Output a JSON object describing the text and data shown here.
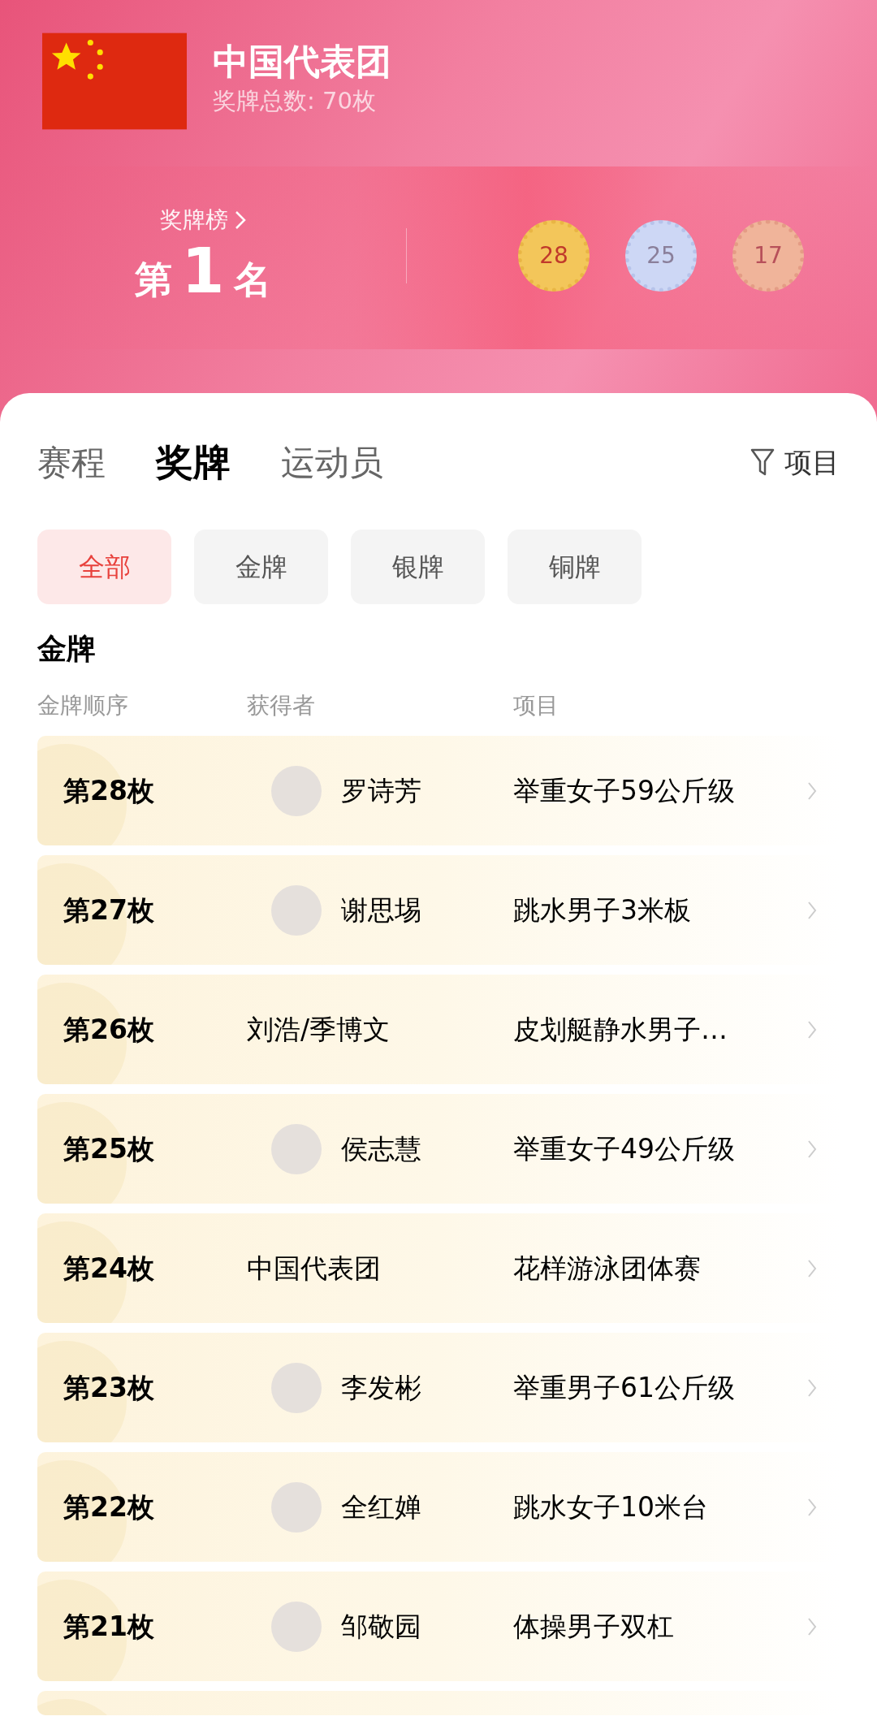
{
  "header": {
    "team": "中国代表团",
    "total": "奖牌总数: 70枚",
    "rank_link": "奖牌榜",
    "rank_prefix": "第",
    "rank": "1",
    "rank_suffix": "名",
    "medals": [
      {
        "kind": "gold",
        "count": "28"
      },
      {
        "kind": "silver",
        "count": "25"
      },
      {
        "kind": "bronze",
        "count": "17"
      }
    ]
  },
  "tabs": [
    {
      "label": "赛程",
      "selected": false
    },
    {
      "label": "奖牌",
      "selected": true
    },
    {
      "label": "运动员",
      "selected": false
    }
  ],
  "filter": {
    "label": "项目"
  },
  "chips": [
    {
      "label": "全部",
      "selected": true
    },
    {
      "label": "金牌",
      "selected": false
    },
    {
      "label": "银牌",
      "selected": false
    },
    {
      "label": "铜牌",
      "selected": false
    }
  ],
  "section_title": "金牌",
  "table": {
    "columns": [
      "金牌顺序",
      "获得者",
      "项目"
    ],
    "rows": [
      {
        "order": "第28枚",
        "kind": "photo",
        "winner": "罗诗芳",
        "event": "举重女子59公斤级"
      },
      {
        "order": "第27枚",
        "kind": "photo",
        "winner": "谢思埸",
        "event": "跳水男子3米板"
      },
      {
        "order": "第26枚",
        "kind": "text",
        "winner": "刘浩/季博文",
        "event": "皮划艇静水男子…"
      },
      {
        "order": "第25枚",
        "kind": "photo",
        "winner": "侯志慧",
        "event": "举重女子49公斤级"
      },
      {
        "order": "第24枚",
        "kind": "text",
        "winner": "中国代表团",
        "event": "花样游泳团体赛"
      },
      {
        "order": "第23枚",
        "kind": "photo",
        "winner": "李发彬",
        "event": "举重男子61公斤级"
      },
      {
        "order": "第22枚",
        "kind": "photo",
        "winner": "全红婵",
        "event": "跳水女子10米台"
      },
      {
        "order": "第21枚",
        "kind": "photo",
        "winner": "邹敬园",
        "event": "体操男子双杠"
      }
    ]
  }
}
